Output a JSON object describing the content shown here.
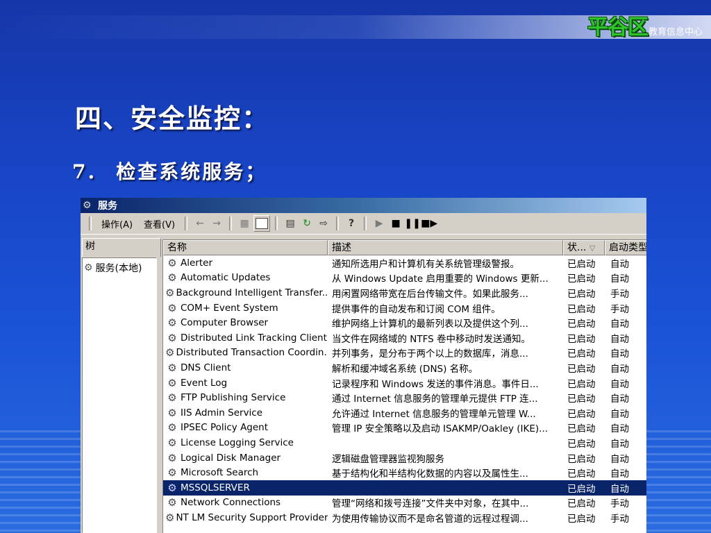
{
  "header": {
    "brand_logo": "平谷区",
    "brand_sub": "教育信息中心"
  },
  "slide": {
    "title": "四、安全监控：",
    "sub_num": "7.",
    "sub_text": "检查系统服务；"
  },
  "window": {
    "title": "服务",
    "menu": {
      "action": "操作(A)",
      "view": "查看(V)"
    },
    "tree_tab": "树",
    "tree_item": "服务(本地)",
    "columns": {
      "name": "名称",
      "desc": "描述",
      "status": "状...",
      "startup": "启动类型"
    },
    "services": [
      {
        "name": "Alerter",
        "desc": "通知所选用户和计算机有关系统管理级警报。",
        "status": "已启动",
        "startup": "自动"
      },
      {
        "name": "Automatic Updates",
        "desc": "从 Windows Update 启用重要的 Windows 更新...",
        "status": "已启动",
        "startup": "自动"
      },
      {
        "name": "Background Intelligent Transfer...",
        "desc": "用闲置网络带宽在后台传输文件。如果此服务...",
        "status": "已启动",
        "startup": "手动"
      },
      {
        "name": "COM+ Event System",
        "desc": "提供事件的自动发布和订阅 COM 组件。",
        "status": "已启动",
        "startup": "手动"
      },
      {
        "name": "Computer Browser",
        "desc": "维护网络上计算机的最新列表以及提供这个列...",
        "status": "已启动",
        "startup": "自动"
      },
      {
        "name": "Distributed Link Tracking Client",
        "desc": "当文件在网络域的 NTFS 卷中移动时发送通知。",
        "status": "已启动",
        "startup": "自动"
      },
      {
        "name": "Distributed Transaction Coordin...",
        "desc": "并列事务，是分布于两个以上的数据库，消息...",
        "status": "已启动",
        "startup": "自动"
      },
      {
        "name": "DNS Client",
        "desc": "解析和缓冲域名系统 (DNS) 名称。",
        "status": "已启动",
        "startup": "自动"
      },
      {
        "name": "Event Log",
        "desc": "记录程序和 Windows 发送的事件消息。事件日...",
        "status": "已启动",
        "startup": "自动"
      },
      {
        "name": "FTP Publishing Service",
        "desc": "通过 Internet 信息服务的管理单元提供 FTP 连...",
        "status": "已启动",
        "startup": "自动"
      },
      {
        "name": "IIS Admin Service",
        "desc": "允许通过 Internet 信息服务的管理单元管理 W...",
        "status": "已启动",
        "startup": "自动"
      },
      {
        "name": "IPSEC Policy Agent",
        "desc": "管理 IP 安全策略以及启动 ISAKMP/Oakley (IKE)...",
        "status": "已启动",
        "startup": "自动"
      },
      {
        "name": "License Logging Service",
        "desc": "",
        "status": "已启动",
        "startup": "自动"
      },
      {
        "name": "Logical Disk Manager",
        "desc": "逻辑磁盘管理器监视狗服务",
        "status": "已启动",
        "startup": "自动"
      },
      {
        "name": "Microsoft Search",
        "desc": "基于结构化和半结构化数据的内容以及属性生...",
        "status": "已启动",
        "startup": "自动"
      },
      {
        "name": "MSSQLSERVER",
        "desc": "",
        "status": "已启动",
        "startup": "自动",
        "selected": true
      },
      {
        "name": "Network Connections",
        "desc": "管理“网络和拨号连接”文件夹中对象，在其中...",
        "status": "已启动",
        "startup": "手动"
      },
      {
        "name": "NT LM Security Support Provider",
        "desc": "为使用传输协议而不是命名管道的远程过程调...",
        "status": "已启动",
        "startup": "手动"
      }
    ]
  },
  "icons": {
    "service": "gear-icon",
    "toolbar": [
      "back-icon",
      "forward-icon",
      "up-folder-icon",
      "show-tree-icon",
      "properties-icon",
      "refresh-icon",
      "export-icon",
      "help-icon",
      "play-icon",
      "stop-icon",
      "pause-icon",
      "restart-icon"
    ]
  }
}
